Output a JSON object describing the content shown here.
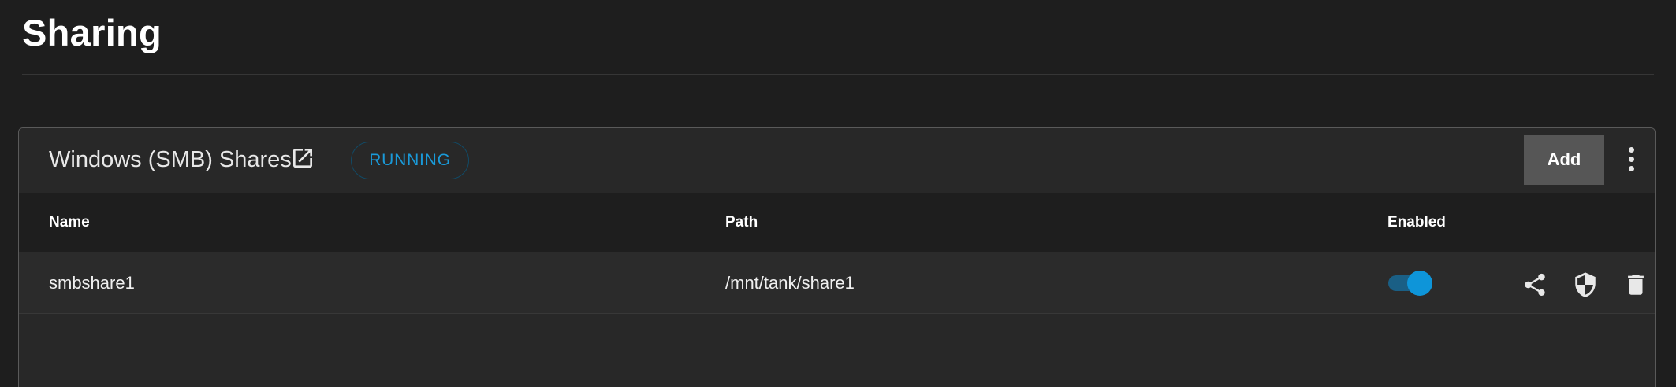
{
  "page": {
    "title": "Sharing"
  },
  "card": {
    "title": "Windows (SMB) Shares",
    "title_icon": "open-in-new-icon",
    "status": "RUNNING",
    "add_label": "Add",
    "menu_icon": "more-vertical-icon"
  },
  "table": {
    "columns": [
      "Name",
      "Path",
      "Enabled"
    ],
    "rows": [
      {
        "name": "smbshare1",
        "path": "/mnt/tank/share1",
        "enabled": true,
        "actions": [
          "share-icon",
          "shield-security-icon",
          "delete-icon"
        ]
      }
    ]
  },
  "colors": {
    "accent": "#0e95d9",
    "status_text": "#1a9ad9",
    "background": "#1e1e1e",
    "card": "#282828",
    "button": "#565656"
  }
}
